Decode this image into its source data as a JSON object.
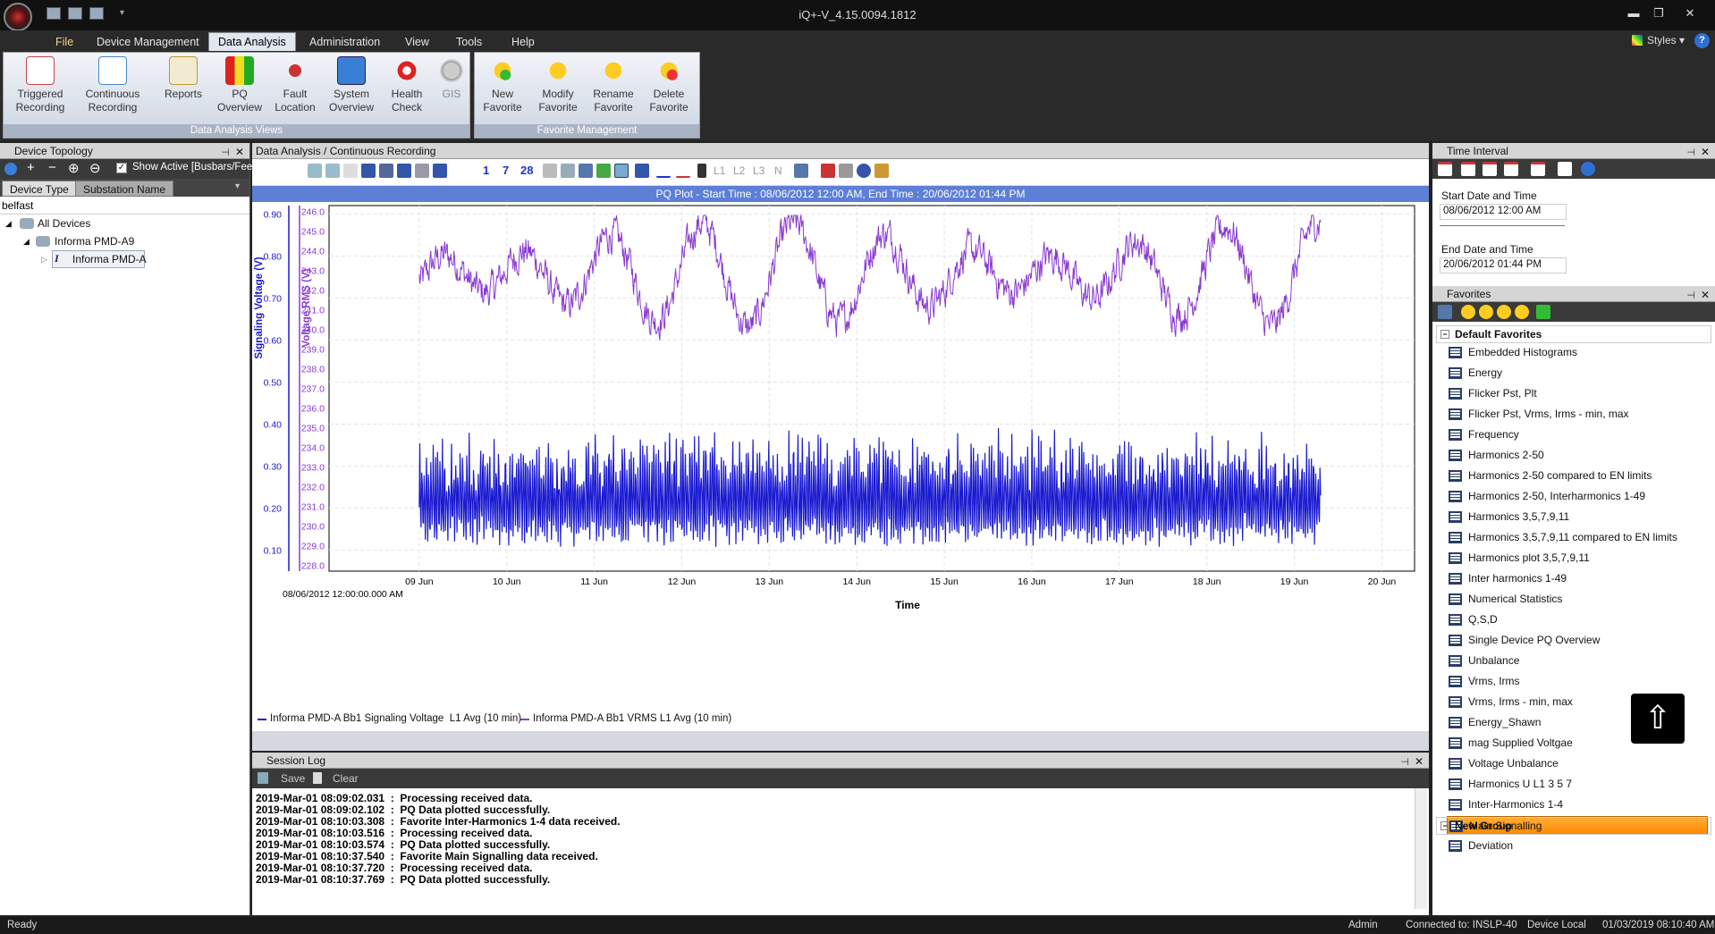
{
  "window": {
    "title": "iQ+-V_4.15.0094.1812"
  },
  "menu": [
    "File",
    "Device Management",
    "Data Analysis",
    "Administration",
    "View",
    "Tools",
    "Help"
  ],
  "menu_active": "Data Analysis",
  "styles_label": "Styles",
  "ribbon": {
    "groups": [
      {
        "label": "Data Analysis Views",
        "buttons": [
          {
            "line1": "Triggered",
            "line2": "Recording",
            "icon": "triggered-recording-icon"
          },
          {
            "line1": "Continuous",
            "line2": "Recording",
            "icon": "continuous-recording-icon"
          },
          {
            "line1": "Reports",
            "line2": "",
            "icon": "reports-icon"
          },
          {
            "line1": "PQ",
            "line2": "Overview",
            "icon": "pq-overview-icon"
          },
          {
            "line1": "Fault",
            "line2": "Location",
            "icon": "fault-location-icon"
          },
          {
            "line1": "System",
            "line2": "Overview",
            "icon": "system-overview-icon"
          },
          {
            "line1": "Health",
            "line2": "Check",
            "icon": "health-check-icon"
          },
          {
            "line1": "GIS",
            "line2": "",
            "icon": "gis-icon"
          }
        ]
      },
      {
        "label": "Favorite Management",
        "buttons": [
          {
            "line1": "New",
            "line2": "Favorite",
            "icon": "new-favorite-icon"
          },
          {
            "line1": "Modify",
            "line2": "Favorite",
            "icon": "modify-favorite-icon"
          },
          {
            "line1": "Rename",
            "line2": "Favorite",
            "icon": "rename-favorite-icon"
          },
          {
            "line1": "Delete",
            "line2": "Favorite",
            "icon": "delete-favorite-icon"
          }
        ]
      }
    ]
  },
  "device_topology": {
    "title": "Device Topology",
    "show_active_label": "Show Active [Busbars/Fee",
    "tabs": [
      "Device Type",
      "Substation Name"
    ],
    "search_value": "belfast",
    "tree": [
      {
        "label": "All Devices",
        "level": 0
      },
      {
        "label": "Informa PMD-A9",
        "level": 1
      },
      {
        "label": "Informa PMD-A",
        "level": 2
      }
    ]
  },
  "center": {
    "title": "Data Analysis / Continuous Recording",
    "toolbar_numbers": [
      "1",
      "7",
      "28"
    ],
    "toolbar_phase": [
      "L1",
      "L2",
      "L3",
      "N"
    ],
    "plot_title": "PQ Plot - Start Time : 08/06/2012 12:00 AM, End Time : 20/06/2012 01:44 PM"
  },
  "chart_data": {
    "type": "line",
    "xlabel": "Time",
    "x_ticks": [
      "09 Jun",
      "10 Jun",
      "11 Jun",
      "12 Jun",
      "13 Jun",
      "14 Jun",
      "15 Jun",
      "16 Jun",
      "17 Jun",
      "18 Jun",
      "19 Jun",
      "20 Jun"
    ],
    "x_start_label": "08/06/2012 12:00:00.000 AM",
    "x_range_days": [
      8.0,
      20.2
    ],
    "left_axis": {
      "label": "Signaling Voltage (V)",
      "ticks": [
        "0.10",
        "0.20",
        "0.30",
        "0.40",
        "0.50",
        "0.60",
        "0.70",
        "0.80",
        "0.90"
      ],
      "range": [
        0.05,
        0.92
      ]
    },
    "right_axis": {
      "label": "Voltage RMS (V)",
      "ticks": [
        "228.0",
        "229.0",
        "230.0",
        "231.0",
        "232.0",
        "233.0",
        "234.0",
        "235.0",
        "236.0",
        "237.0",
        "238.0",
        "239.0",
        "240.0",
        "241.0",
        "242.0",
        "243.0",
        "244.0",
        "245.0",
        "246.0"
      ],
      "range": [
        227.7,
        246.3
      ]
    },
    "series": [
      {
        "name": "Informa PMD-A Bb1 Signaling Voltage  L1 Avg (10 min)",
        "axis": "left",
        "color": "#1a1ad0",
        "x_days": [
          9.0,
          19.3
        ],
        "approx_min": 0.08,
        "approx_max": 0.43,
        "mean": 0.22
      },
      {
        "name": "Informa PMD-A Bb1 VRMS L1 Avg (10 min)",
        "axis": "right",
        "color": "#8a3ad0",
        "x_days": [
          9.0,
          19.3
        ],
        "approx_min": 237.7,
        "approx_max": 245.8,
        "mean": 242.8
      }
    ]
  },
  "session_log": {
    "title": "Session Log",
    "save_label": "Save",
    "clear_label": "Clear",
    "lines": [
      "2019-Mar-01 08:09:02.031  :  Processing received data.",
      "2019-Mar-01 08:09:02.102  :  PQ Data plotted successfully.",
      "2019-Mar-01 08:10:03.308  :  Favorite Inter-Harmonics 1-4 data received.",
      "2019-Mar-01 08:10:03.516  :  Processing received data.",
      "2019-Mar-01 08:10:03.574  :  PQ Data plotted successfully.",
      "2019-Mar-01 08:10:37.540  :  Favorite Main Signalling data received.",
      "2019-Mar-01 08:10:37.720  :  Processing received data.",
      "2019-Mar-01 08:10:37.769  :  PQ Data plotted successfully."
    ]
  },
  "time_interval": {
    "title": "Time Interval",
    "start_label": "Start Date and Time",
    "start_value": "08/06/2012 12:00 AM",
    "end_label": "End Date and Time",
    "end_value": "20/06/2012 01:44 PM"
  },
  "favorites": {
    "title": "Favorites",
    "group_default": "Default Favorites",
    "group_new": "New Group",
    "items": [
      "Embedded Histograms",
      "Energy",
      "Flicker Pst, Plt",
      "Flicker Pst, Vrms, Irms - min, max",
      "Frequency",
      "Harmonics 2-50",
      "Harmonics 2-50 compared to EN limits",
      "Harmonics 2-50, Interharmonics 1-49",
      "Harmonics 3,5,7,9,11",
      "Harmonics 3,5,7,9,11 compared to  EN limits",
      "Harmonics plot 3,5,7,9,11",
      "Inter harmonics 1-49",
      "Numerical Statistics",
      "Q,S,D",
      "Single Device PQ Overview",
      "Unbalance",
      "Vrms, Irms",
      "Vrms, Irms - min, max",
      "Energy_Shawn",
      "mag Supplied Voltgae",
      "Voltage Unbalance",
      "Harmonics U L1 3 5 7",
      "Inter-Harmonics 1-4",
      "Main Signalling",
      "Deviation"
    ],
    "selected": "Main Signalling"
  },
  "status": {
    "ready": "Ready",
    "user": "Admin",
    "connection": "Connected to: INSLP-40",
    "mode": "Device Local",
    "datetime": "01/03/2019 08:10:40 AM"
  }
}
